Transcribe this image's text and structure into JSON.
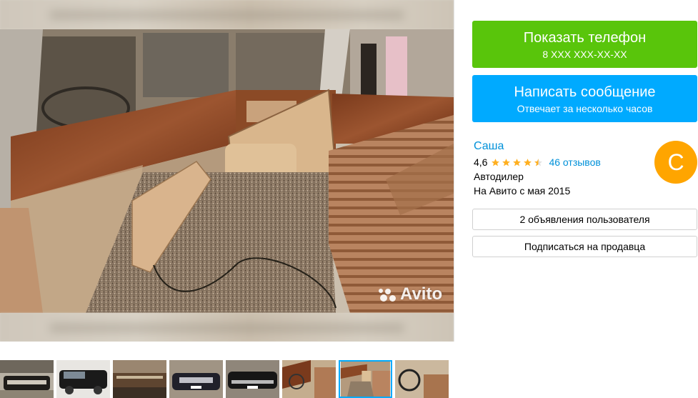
{
  "gallery": {
    "watermark": "Avito",
    "thumbnails_count": 8,
    "active_thumbnail": 7
  },
  "contact": {
    "phone_button_label": "Показать телефон",
    "phone_masked": "8 XXX XXX-XX-XX",
    "message_button_label": "Написать сообщение",
    "message_button_sub": "Отвечает за несколько часов"
  },
  "seller": {
    "name": "Саша",
    "rating": "4,6",
    "rating_value": 4.6,
    "reviews_label": "46 отзывов",
    "type": "Автодилер",
    "since": "На Авито с мая 2015",
    "avatar_letter": "С"
  },
  "actions": {
    "user_ads_label": "2 объявления пользователя",
    "subscribe_label": "Подписаться на продавца"
  },
  "colors": {
    "phone_button": "#59c50b",
    "message_button": "#00aaff",
    "link": "#0091d9",
    "avatar": "#ffa500",
    "star": "#ffb021"
  }
}
